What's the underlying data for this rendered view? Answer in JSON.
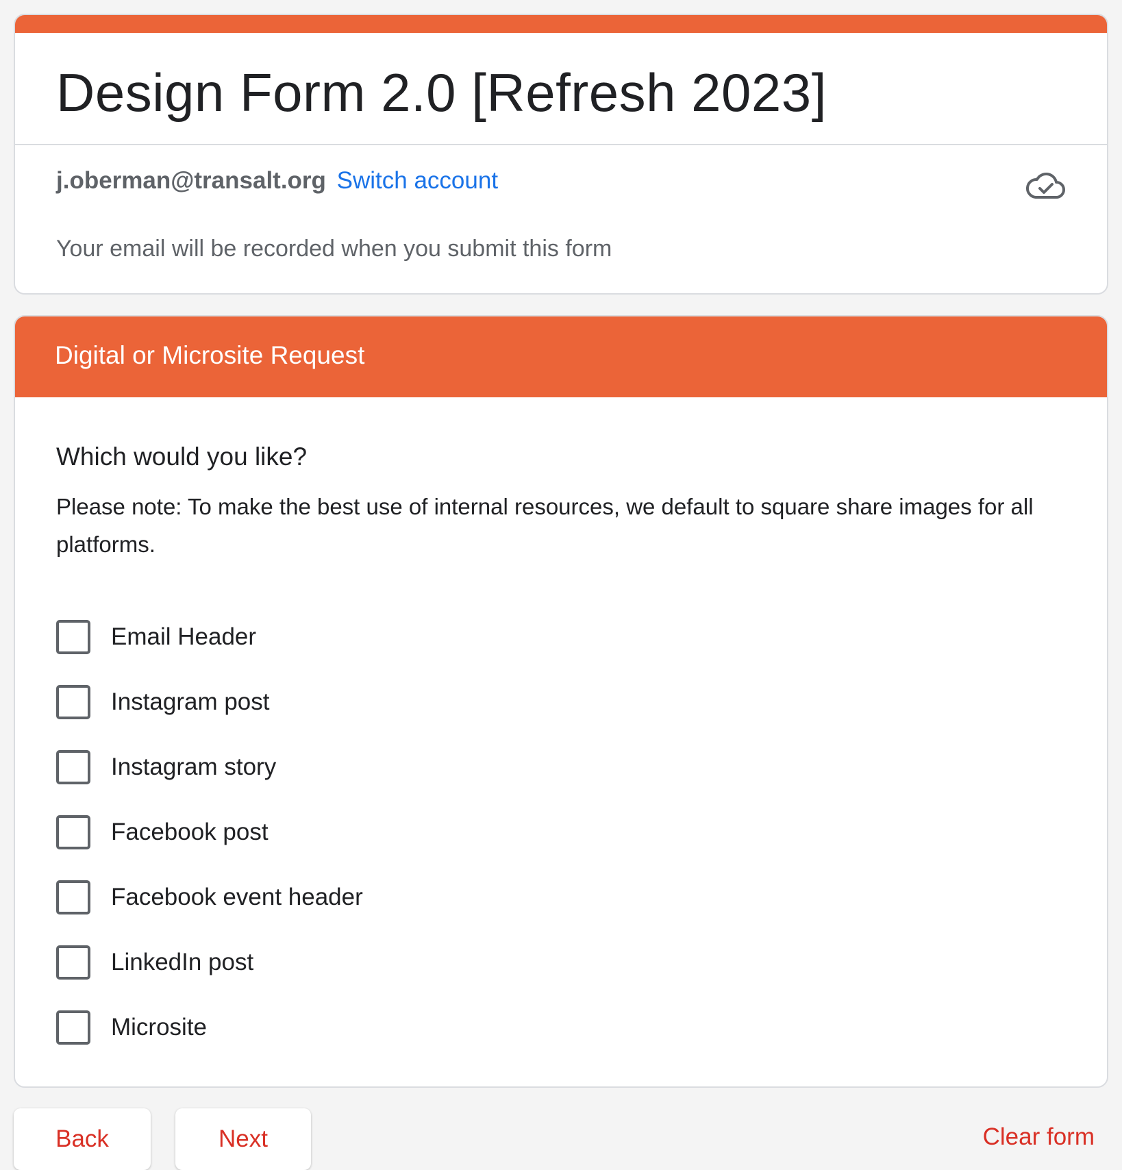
{
  "header": {
    "title": "Design Form 2.0 [Refresh 2023]",
    "account_email": "j.oberman@transalt.org",
    "switch_account_label": "Switch account",
    "email_note": "Your email will be recorded when you submit this form",
    "cloud_icon": "cloud-check-icon"
  },
  "section": {
    "title": "Digital or Microsite Request",
    "question": {
      "title": "Which would you like?",
      "description": "Please note: To make the best use of internal resources, we default to square share images for all platforms.",
      "options": [
        {
          "label": "Email Header",
          "checked": false
        },
        {
          "label": "Instagram post",
          "checked": false
        },
        {
          "label": "Instagram story",
          "checked": false
        },
        {
          "label": "Facebook post",
          "checked": false
        },
        {
          "label": "Facebook event header",
          "checked": false
        },
        {
          "label": "LinkedIn post",
          "checked": false
        },
        {
          "label": "Microsite",
          "checked": false
        }
      ]
    }
  },
  "footer": {
    "back_label": "Back",
    "next_label": "Next",
    "clear_label": "Clear form"
  },
  "colors": {
    "accent": "#eb6438",
    "link": "#1a73e8",
    "button_text": "#d93025",
    "background": "#f4f4f4"
  }
}
